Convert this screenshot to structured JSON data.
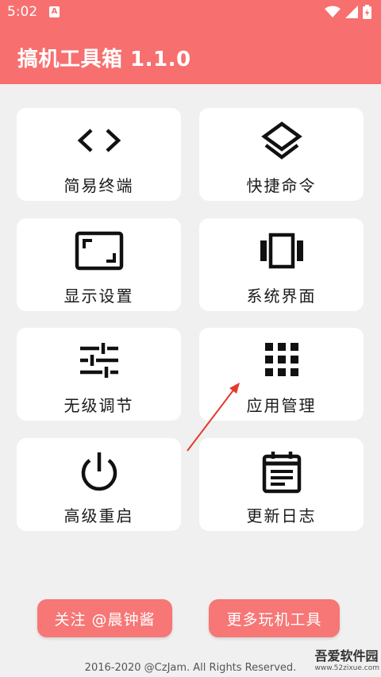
{
  "status_bar": {
    "time": "5:02",
    "notification_letter": "A"
  },
  "app": {
    "title": "搞机工具箱 1.1.0",
    "accent_color": "#f76f6f"
  },
  "grid": [
    {
      "label": "简易终端",
      "icon": "code-brackets-icon"
    },
    {
      "label": "快捷命令",
      "icon": "layers-icon"
    },
    {
      "label": "显示设置",
      "icon": "aspect-ratio-icon"
    },
    {
      "label": "系统界面",
      "icon": "carousel-icon"
    },
    {
      "label": "无级调节",
      "icon": "sliders-icon"
    },
    {
      "label": "应用管理",
      "icon": "apps-grid-icon"
    },
    {
      "label": "高级重启",
      "icon": "power-icon"
    },
    {
      "label": "更新日志",
      "icon": "calendar-notes-icon"
    }
  ],
  "buttons": {
    "follow": "关注 @晨钟酱",
    "more": "更多玩机工具"
  },
  "footer": "2016-2020 @CzJam. All Rights Reserved.",
  "watermark": {
    "name": "吾爱软件园",
    "url": "www.52zixue.com"
  }
}
